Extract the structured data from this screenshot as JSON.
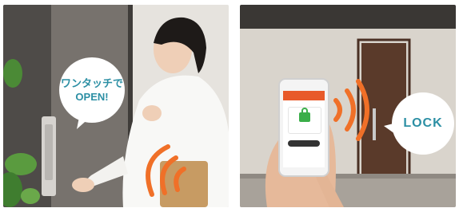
{
  "left_panel": {
    "bubble_text_line1": "ワンタッチで",
    "bubble_text_line2": "OPEN!"
  },
  "right_panel": {
    "bubble_text": "LOCK"
  },
  "colors": {
    "bubble_text": "#2c8fa4",
    "signal_waves": "#f07028",
    "app_accent": "#e85a2a",
    "lock_icon": "#3aae49"
  }
}
